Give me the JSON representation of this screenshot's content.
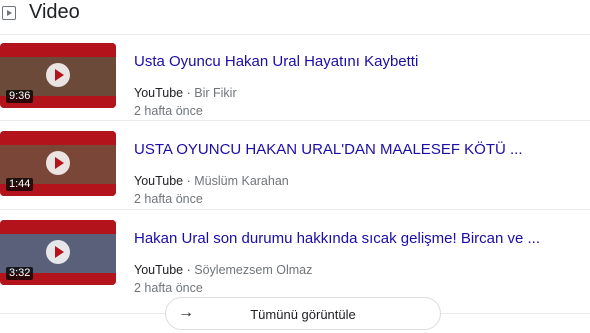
{
  "section": {
    "title": "Video",
    "view_all_label": "Tümünü görüntüle"
  },
  "videos": [
    {
      "title": "Usta Oyuncu Hakan Ural Hayatını Kaybetti",
      "source": "YouTube",
      "channel": "Bir Fikir",
      "age": "2 hafta önce",
      "duration": "9:36",
      "thumb_color": "#6b4a3a"
    },
    {
      "title": "USTA OYUNCU HAKAN URAL'DAN MAALESEF KÖTÜ ...",
      "source": "YouTube",
      "channel": "Müslüm Karahan",
      "age": "2 hafta önce",
      "duration": "1:44",
      "thumb_color": "#7a4638"
    },
    {
      "title": "Hakan Ural son durumu hakkında sıcak gelişme! Bircan ve ...",
      "source": "YouTube",
      "channel": "Söylemezsem Olmaz",
      "age": "2 hafta önce",
      "duration": "3:32",
      "thumb_color": "#5a5f7a"
    }
  ]
}
